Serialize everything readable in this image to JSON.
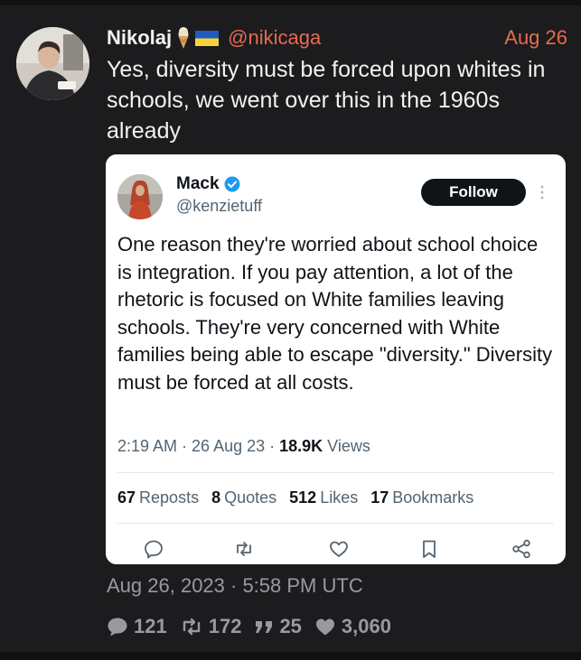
{
  "post": {
    "author_name": "Nikolaj",
    "handle": "@nikicaga",
    "date": "Aug 26",
    "text": "Yes, diversity must be forced upon whites in schools, we went over this in the 1960s already",
    "timestamp": "Aug 26, 2023 · 5:58 PM UTC",
    "stats": {
      "replies": "121",
      "reposts": "172",
      "quotes": "25",
      "likes": "3,060"
    },
    "icons": [
      "ice-cream-emoji",
      "ukraine-flag",
      "reply-icon",
      "repost-icon",
      "quote-icon",
      "heart-icon"
    ]
  },
  "quoted": {
    "name": "Mack",
    "handle": "@kenzietuff",
    "follow_label": "Follow",
    "text": "One reason they're worried about school choice is integration. If you pay attention, a lot of the rhetoric is focused on White families leaving schools. They're very concerned with White families being able to escape \"diversity.\" Diversity must be forced at all costs.",
    "time": "2:19 AM · 26 Aug 23 · ",
    "views_count": "18.9K",
    "views_label": " Views",
    "reposts_count": "67",
    "reposts_label": "Reposts",
    "quotes_count": "8",
    "quotes_label": "Quotes",
    "likes_count": "512",
    "likes_label": "Likes",
    "bookmarks_count": "17",
    "bookmarks_label": "Bookmarks",
    "icons": [
      "verified-badge",
      "more-icon",
      "reply-icon",
      "repost-icon",
      "like-icon",
      "bookmark-icon",
      "share-icon"
    ]
  },
  "colors": {
    "background": "#1c1c1e",
    "accent": "#e86a4f",
    "card": "#ffffff",
    "verified": "#1d9bf0",
    "muted": "#9a9a9e"
  }
}
